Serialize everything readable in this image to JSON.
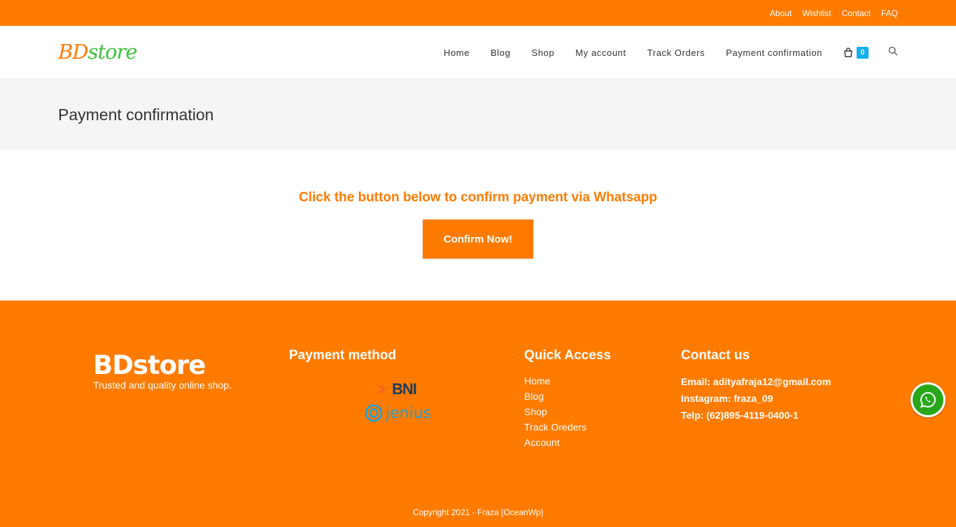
{
  "topbar": {
    "links": [
      "About",
      "Wishlist",
      "Contact",
      "FAQ"
    ]
  },
  "header": {
    "logo_part1": "BD",
    "logo_part2": "store",
    "nav": [
      "Home",
      "Blog",
      "Shop",
      "My account",
      "Track Orders",
      "Payment confirmation"
    ],
    "cart_count": "0"
  },
  "page": {
    "title": "Payment confirmation",
    "cta_text": "Click the button below to confirm payment via Whatsapp",
    "cta_button": "Confirm Now!"
  },
  "footer": {
    "brand": "BDstore",
    "tagline": "Trusted and quality online shop.",
    "payment_heading": "Payment method",
    "payment_logos": [
      "BNI",
      "jenius"
    ],
    "quick_heading": "Quick Access",
    "quick_links": [
      "Home",
      "Blog",
      "Shop",
      "Track Oreders",
      "Account"
    ],
    "contact_heading": "Contact us",
    "contact_lines": [
      "Email: adityafraja12@gmail.com",
      "Instagram: fraza_09",
      "Telp: (62)895-4119-0400-1"
    ],
    "copyright": "Copyright 2021 - Fraza [OceanWp]"
  },
  "colors": {
    "brand_orange": "#ff7b00",
    "logo_green": "#3cc33c",
    "cart_badge": "#13aff0",
    "whatsapp_green": "#29a71a"
  },
  "icons": [
    "shopping-bag-icon",
    "search-icon",
    "whatsapp-icon"
  ]
}
